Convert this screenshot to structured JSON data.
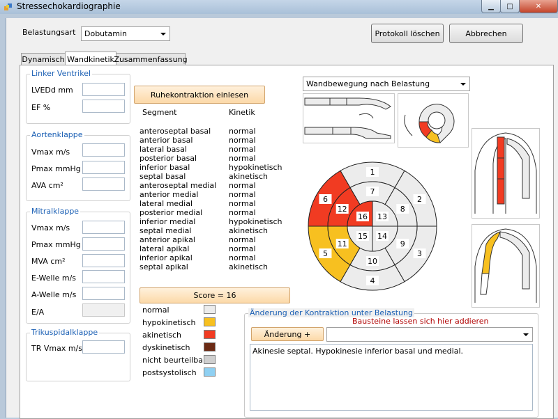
{
  "window": {
    "title": "Stressechokardiographie"
  },
  "header": {
    "belastungsart_label": "Belastungsart",
    "belastungsart_value": "Dobutamin",
    "protokoll_button": "Protokoll löschen",
    "abbrechen_button": "Abbrechen"
  },
  "tabs": [
    {
      "label": "Dynamisch"
    },
    {
      "label": "Wandkinetik"
    },
    {
      "label": "Zusammenfassung"
    }
  ],
  "left": {
    "lv": {
      "title": "Linker Ventrikel",
      "fields": [
        "LVEDd mm",
        "EF %"
      ]
    },
    "ak": {
      "title": "Aortenklappe",
      "fields": [
        "Vmax m/s",
        "Pmax mmHg",
        "AVA cm²"
      ]
    },
    "mk": {
      "title": "Mitralklappe",
      "fields": [
        "Vmax m/s",
        "Pmax mmHg",
        "MVA cm²",
        "E-Welle m/s",
        "A-Welle m/s",
        "E/A"
      ]
    },
    "tk": {
      "title": "Trikuspidalklappe",
      "fields": [
        "TR Vmax m/s"
      ]
    }
  },
  "middle": {
    "ruhe_button": "Ruhekontraktion einlesen",
    "col_segment": "Segment",
    "col_kinetik": "Kinetik",
    "segments": [
      [
        "anteroseptal basal",
        "normal"
      ],
      [
        "anterior basal",
        "normal"
      ],
      [
        "lateral basal",
        "normal"
      ],
      [
        "posterior basal",
        "normal"
      ],
      [
        "inferior basal",
        "hypokinetisch"
      ],
      [
        "septal basal",
        "akinetisch"
      ],
      [
        "anteroseptal medial",
        "normal"
      ],
      [
        "anterior medial",
        "normal"
      ],
      [
        "lateral medial",
        "normal"
      ],
      [
        "posterior medial",
        "normal"
      ],
      [
        "inferior medial",
        "hypokinetisch"
      ],
      [
        "septal medial",
        "akinetisch"
      ],
      [
        "anterior apikal",
        "normal"
      ],
      [
        "lateral apikal",
        "normal"
      ],
      [
        "inferior apikal",
        "normal"
      ],
      [
        "septal apikal",
        "akinetisch"
      ]
    ],
    "score_button": "Score = 16",
    "legend": [
      {
        "label": "normal",
        "color": "#ececec"
      },
      {
        "label": "hypokinetisch",
        "color": "#f7c020"
      },
      {
        "label": "akinetisch",
        "color": "#f13b22"
      },
      {
        "label": "dyskinetisch",
        "color": "#6b2a14"
      },
      {
        "label": "nicht beurteilbar",
        "color": "#cfcfcf"
      },
      {
        "label": "postsystolisch",
        "color": "#8fd0f2"
      }
    ]
  },
  "right": {
    "view_select": "Wandbewegung nach Belastung",
    "bullseye": {
      "outer": [
        "1",
        "2",
        "3",
        "4",
        "5",
        "6"
      ],
      "middle": [
        "7",
        "8",
        "9",
        "10",
        "11",
        "12"
      ],
      "apex": [
        "13",
        "14",
        "15",
        "16"
      ]
    },
    "colors": {
      "normal": "#ececec",
      "hypo": "#f7c020",
      "akin": "#f13b22"
    },
    "aenderung": {
      "title": "Änderung der Kontraktion unter Belastung",
      "hint": "Bausteine lassen sich hier addieren",
      "button": "Änderung +",
      "text": "Akinesie septal. Hypokinesie inferior basal und medial."
    }
  }
}
